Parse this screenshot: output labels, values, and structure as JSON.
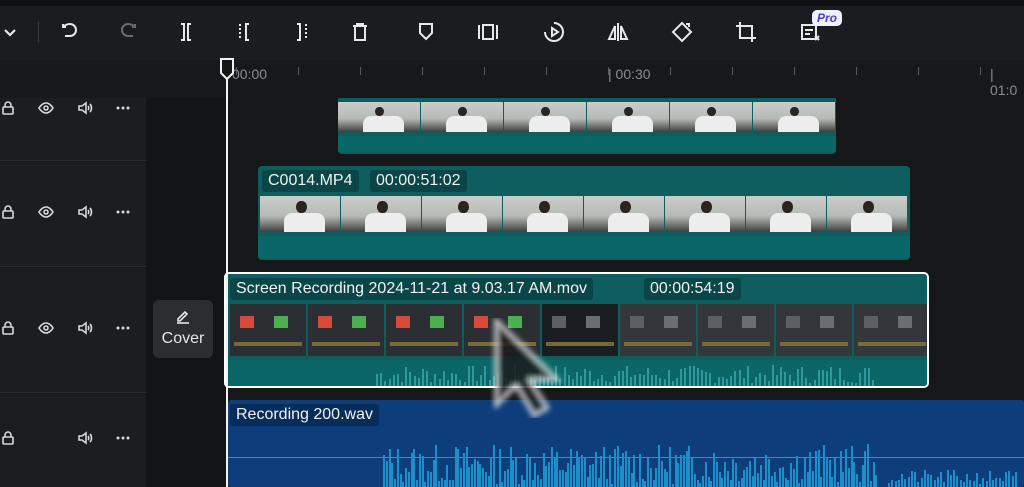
{
  "toolbar": {
    "tools": [
      {
        "name": "collapse-chevron-icon"
      },
      {
        "name": "undo-icon"
      },
      {
        "name": "redo-icon"
      },
      {
        "name": "split-icon"
      },
      {
        "name": "trim-left-icon"
      },
      {
        "name": "trim-right-icon"
      },
      {
        "name": "delete-icon"
      },
      {
        "name": "marker-icon"
      },
      {
        "name": "freeze-frame-icon"
      },
      {
        "name": "speed-play-icon"
      },
      {
        "name": "mirror-icon"
      },
      {
        "name": "rotate-icon"
      },
      {
        "name": "crop-icon"
      },
      {
        "name": "pro-feature-icon"
      }
    ],
    "pro_badge": "Pro"
  },
  "ruler": {
    "labels": [
      "00:00",
      "| 00:30",
      "| 01:0"
    ]
  },
  "cover": {
    "label": "Cover"
  },
  "clips": {
    "top": {
      "title": ""
    },
    "c0014": {
      "name": "C0014.MP4",
      "duration": "00:00:51:02"
    },
    "screen": {
      "name": "Screen Recording 2024-11-21 at 9.03.17 AM.mov",
      "duration": "00:00:54:19"
    },
    "audio": {
      "name": "Recording 200.wav"
    }
  },
  "colors": {
    "video_clip": "#0e5d5f",
    "audio_clip": "#0d3d7a",
    "playhead": "#f2f2f2",
    "pro_badge_text": "#4b3bd0"
  }
}
